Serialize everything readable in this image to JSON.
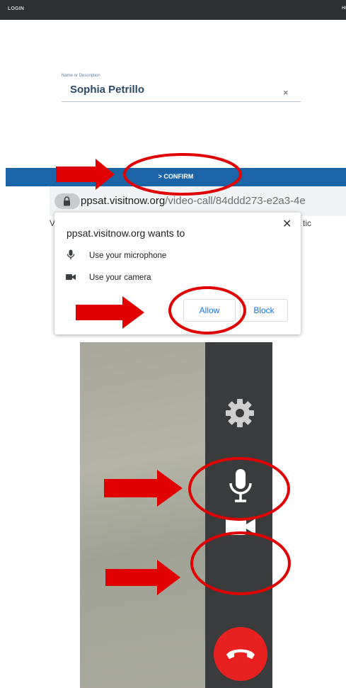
{
  "top_bar": {
    "login_label": "LOGIN",
    "edge_label": "HI"
  },
  "name_field": {
    "label": "Name or Description",
    "value": "Sophia Petrillo",
    "clear_glyph": "×"
  },
  "confirm": {
    "label": "> CONFIRM"
  },
  "browser": {
    "url_host": "ppsat.visitnow.org",
    "url_path": "/video-call/84ddd273-e2a3-4e",
    "behind_left": "V",
    "behind_right": "tic"
  },
  "permission_dialog": {
    "title": "ppsat.visitnow.org wants to",
    "close_glyph": "✕",
    "items": [
      {
        "icon": "microphone-icon",
        "label": "Use your microphone"
      },
      {
        "icon": "camera-icon",
        "label": "Use your camera"
      }
    ],
    "allow_label": "Allow",
    "block_label": "Block"
  },
  "video_call": {
    "controls": [
      "settings-gear-icon",
      "microphone-icon",
      "camera-icon",
      "hang-up-icon"
    ]
  },
  "colors": {
    "confirm_bar": "#1a64a8",
    "annotation_red": "#e00000",
    "hangup_red": "#e8201f",
    "link_blue": "#1a73e8",
    "panel_dark": "#3a3b3d"
  }
}
